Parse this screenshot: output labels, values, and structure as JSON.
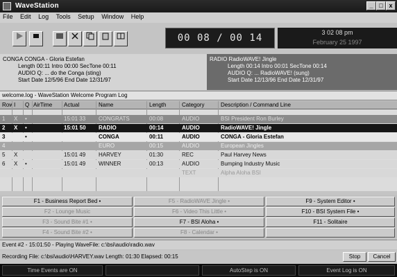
{
  "window": {
    "title": "WaveStation",
    "minimize": "_",
    "maximize": "□",
    "close": "x"
  },
  "menu": [
    "File",
    "Edit",
    "Log",
    "Tools",
    "Setup",
    "Window",
    "Help"
  ],
  "toolbar": {
    "play_icon": "play-icon",
    "stop_icon": "stop-icon"
  },
  "transport": {
    "time": "00 08 / 00 14"
  },
  "clock": {
    "time": "3 02 08 pm",
    "date": "February 25 1997"
  },
  "current": {
    "line1": "CONGA  CONGA - Gloria Estefan",
    "line2": "Length  00:11  Intro  00:00  SecTone  00:11",
    "line3": "AUDIO  Q: ... do the Conga (sting)",
    "line4": "Start Date  12/5/96  End Date  12/31/97"
  },
  "next": {
    "line1": "RADIO  RadioWAVE! Jingle",
    "line2": "Length  00:14  Intro  00:01  SecTone  00:14",
    "line3": "AUDIO  Q: ... RadioWAVE! (sung)",
    "line4": "Start Date  12/13/96  End Date  12/31/97"
  },
  "log": {
    "header": "welcome.log - WaveStation Welcome Program Log"
  },
  "table": {
    "columns": [
      "Row",
      "I",
      "Q",
      "AirTime",
      "Actual",
      "Name",
      "Length",
      "Category",
      "Description / Command Line"
    ],
    "rows": [
      {
        "row": "1",
        "i": "X",
        "q": "•",
        "airtime": "",
        "actual": "15:01 33",
        "name": "CONGRATS",
        "length": "00:08",
        "category": "AUDIO",
        "desc": "BSI President Ron Burley"
      },
      {
        "row": "2",
        "i": "X",
        "q": "•",
        "airtime": "",
        "actual": "15:01 50",
        "name": "RADIO",
        "length": "00:14",
        "category": "AUDIO",
        "desc": "RadioWAVE! Jingle"
      },
      {
        "row": "3",
        "i": "",
        "q": "•",
        "airtime": "",
        "actual": "",
        "name": "CONGA",
        "length": "00:11",
        "category": "AUDIO",
        "desc": "CONGA - Gloria Estefan"
      },
      {
        "row": "4",
        "i": "",
        "q": "",
        "airtime": "",
        "actual": "",
        "name": "EURO",
        "length": "00:15",
        "category": "AUDIO",
        "desc": "European Jingles"
      },
      {
        "row": "5",
        "i": "X",
        "q": "",
        "airtime": "",
        "actual": "15:01 49",
        "name": "HARVEY",
        "length": "01:30",
        "category": "REC",
        "desc": "Paul Harvey News"
      },
      {
        "row": "6",
        "i": "X",
        "q": "•",
        "airtime": "",
        "actual": "15:01 49",
        "name": "WINNER",
        "length": "00:13",
        "category": "AUDIO",
        "desc": "Bumping Industry Music"
      },
      {
        "row": "",
        "i": "",
        "q": "",
        "airtime": "",
        "actual": "",
        "name": "",
        "length": "",
        "category": "TEXT",
        "desc": "Alpha Aloha BSI"
      }
    ]
  },
  "fkeys": {
    "f1": "F1 - Business Report Bed  •",
    "f2": "F2 - Lounge Music",
    "f3": "F3 - Sound Bite #1  •",
    "f4": "F4 - Sound Bite #2  •",
    "f5": "F5 - RadioWAVE Jingle  •",
    "f6": "F6 - Video This Little  •",
    "f7": "F7 - BSI Aloha  •",
    "f8": "F8 - Calendar  •",
    "f9": "F9 - System Editor  •",
    "f10": "F10 - BSI System File  •",
    "f11": "F11 - Solitaire",
    "f12": ""
  },
  "status": {
    "event": "Event #2 - 15:01:50 - Playing WaveFile: c:\\bsi\\audio\\radio.wav",
    "recording": "Recording File: c:\\bsi\\audio\\HARVEY.wav  Length: 01:30  Elapsed: 00:15",
    "stop": "Stop",
    "cancel": "Cancel"
  },
  "bottom": {
    "time_events": "Time Events are ON",
    "autostep": "AutoStep is ON",
    "eventlog": "Event Log is ON"
  }
}
